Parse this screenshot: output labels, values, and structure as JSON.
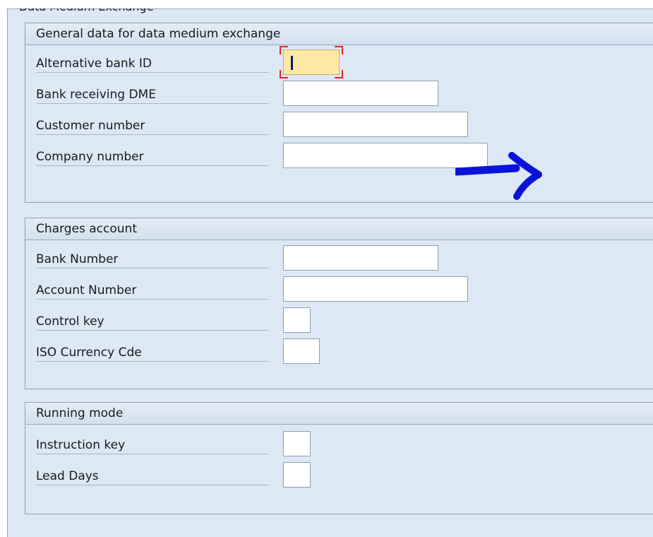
{
  "screen": {
    "title": "Data Medium Exchange"
  },
  "groups": [
    {
      "title": "General data for data medium exchange",
      "fields": [
        {
          "label": "Alternative bank ID",
          "value": "",
          "active": true
        },
        {
          "label": "Bank receiving DME",
          "value": ""
        },
        {
          "label": "Customer number",
          "value": ""
        },
        {
          "label": "Company number",
          "value": ""
        }
      ]
    },
    {
      "title": "Charges account",
      "fields": [
        {
          "label": "Bank Number",
          "value": ""
        },
        {
          "label": "Account Number",
          "value": ""
        },
        {
          "label": "Control key",
          "value": ""
        },
        {
          "label": "ISO Currency Cde",
          "value": ""
        }
      ]
    },
    {
      "title": "Running mode",
      "fields": [
        {
          "label": "Instruction key",
          "value": ""
        },
        {
          "label": "Lead Days",
          "value": ""
        }
      ]
    }
  ],
  "annotation": {
    "icon": "right-arrow-icon",
    "color": "#0a14d8"
  },
  "colors": {
    "panel_background": "#dce8f4",
    "active_field": "#fde9a4",
    "focus_marker": "#e3262b"
  }
}
